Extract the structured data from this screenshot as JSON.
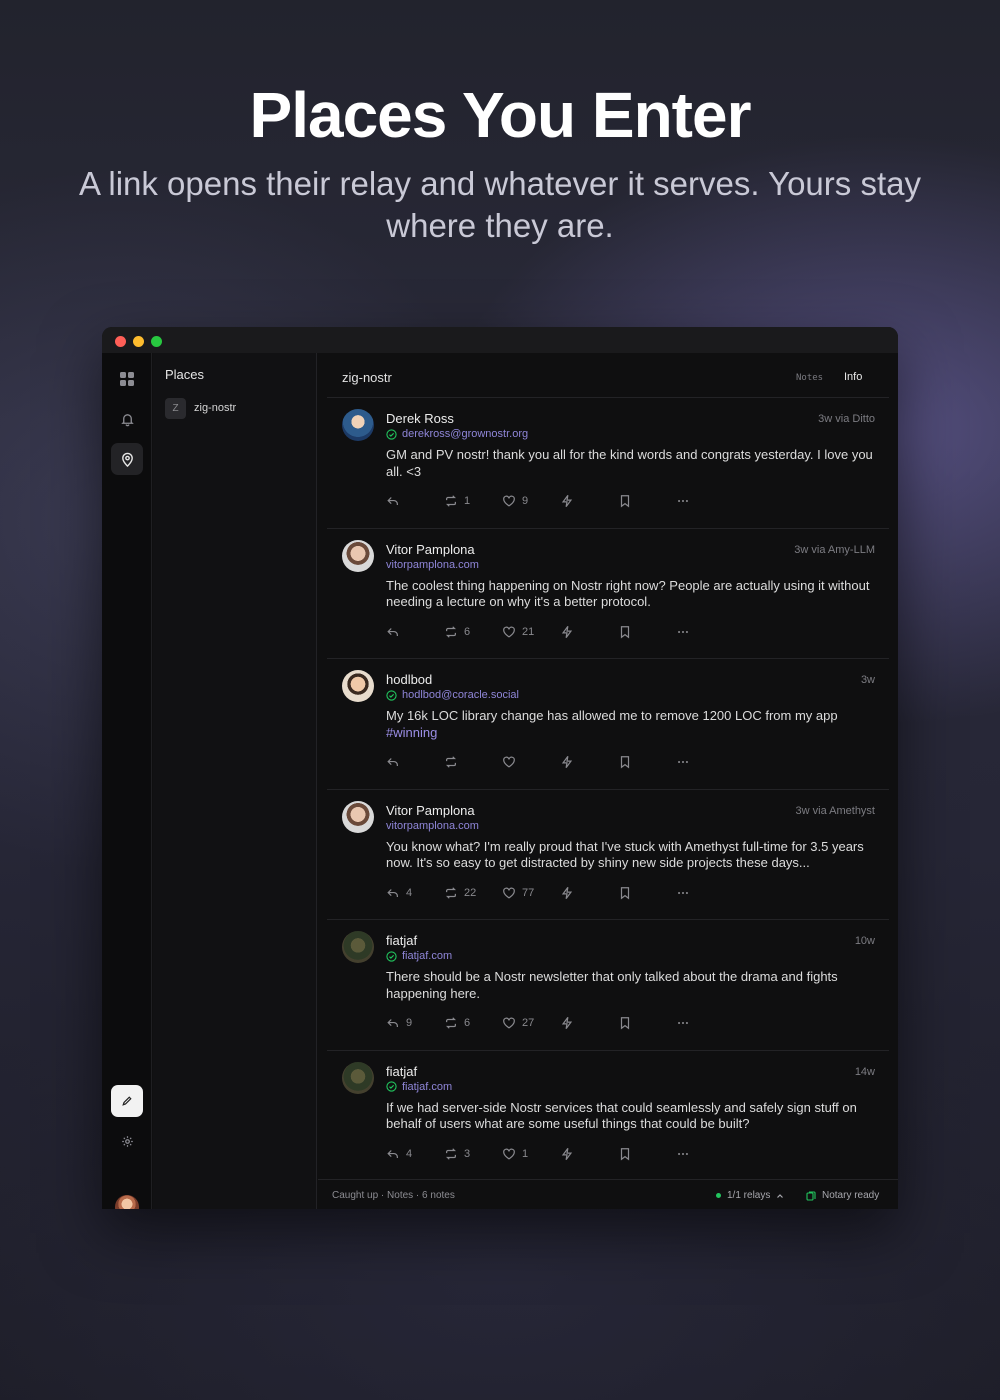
{
  "hero": {
    "title": "Places You Enter",
    "subtitle": "A link opens their relay and whatever it serves. Yours stay where they are."
  },
  "sidebar": {
    "rail_icons": [
      "apps-icon",
      "bell-icon",
      "map-pin-icon",
      "compose-icon",
      "gear-icon",
      "avatar"
    ],
    "active": "map-pin-icon"
  },
  "places": {
    "title": "Places",
    "items": [
      {
        "badge": "Z",
        "label": "zig-nostr"
      }
    ]
  },
  "main": {
    "title": "zig-nostr",
    "tabs": {
      "notes": "Notes",
      "info": "Info"
    }
  },
  "feed": [
    {
      "name": "Derek Ross",
      "handle": "derekross@grownostr.org",
      "verified": true,
      "time": "3w via Ditto",
      "text": "GM and PV nostr! thank you all for the kind words and congrats yesterday. I love you all. <3",
      "replies": "",
      "reposts": "1",
      "likes": "9"
    },
    {
      "name": "Vitor Pamplona",
      "handle": "vitorpamplona.com",
      "verified": false,
      "time": "3w via Amy-LLM",
      "text": "The coolest thing happening on Nostr right now? People are actually using it without needing a lecture on why it's a better protocol.",
      "replies": "",
      "reposts": "6",
      "likes": "21"
    },
    {
      "name": "hodlbod",
      "handle": "hodlbod@coracle.social",
      "verified": true,
      "time": "3w",
      "text": "My 16k LOC library change has allowed me to remove 1200 LOC from my app ",
      "hashtag": "#winning",
      "replies": "",
      "reposts": "",
      "likes": ""
    },
    {
      "name": "Vitor Pamplona",
      "handle": "vitorpamplona.com",
      "verified": false,
      "time": "3w via Amethyst",
      "text": "You know what? I'm really proud that I've stuck with Amethyst full-time for 3.5 years now. It's so easy to get distracted by shiny new side projects these days...",
      "replies": "4",
      "reposts": "22",
      "likes": "77"
    },
    {
      "name": "fiatjaf",
      "handle": "fiatjaf.com",
      "verified": true,
      "time": "10w",
      "text": "There should be a Nostr newsletter that only talked about the drama and fights happening here.",
      "replies": "9",
      "reposts": "6",
      "likes": "27"
    },
    {
      "name": "fiatjaf",
      "handle": "fiatjaf.com",
      "verified": true,
      "time": "14w",
      "text": "If we had server-side Nostr services that could seamlessly and safely sign stuff on behalf of users what are some useful things that could be built?",
      "replies": "4",
      "reposts": "3",
      "likes": "1"
    }
  ],
  "status": {
    "left": "Caught up · Notes · 6 notes",
    "relays": "1/1 relays",
    "notary": "Notary ready"
  },
  "colors": {
    "accent_link": "#8f86d8",
    "verified_green": "#22c55e"
  }
}
